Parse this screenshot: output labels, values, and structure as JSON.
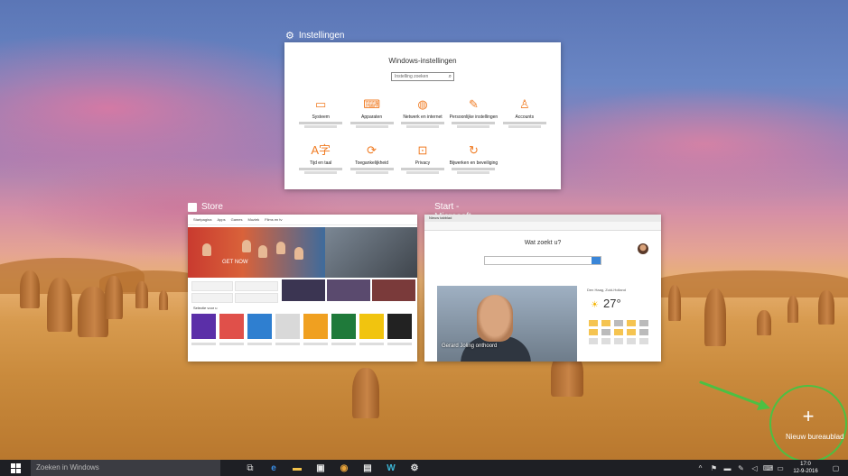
{
  "windows": {
    "settings": {
      "title": "Instellingen",
      "heading": "Windows-instellingen",
      "search_placeholder": "Instelling zoeken",
      "items": [
        {
          "label": "Systeem",
          "icon": "laptop-icon",
          "glyph": "▭"
        },
        {
          "label": "Apparaten",
          "icon": "keyboard-icon",
          "glyph": "⌨"
        },
        {
          "label": "Netwerk en internet",
          "icon": "globe-icon",
          "glyph": "◍"
        },
        {
          "label": "Persoonlijke instellingen",
          "icon": "brush-icon",
          "glyph": "✎"
        },
        {
          "label": "Accounts",
          "icon": "person-icon",
          "glyph": "♙"
        },
        {
          "label": "Tijd en taal",
          "icon": "time-language-icon",
          "glyph": "A字"
        },
        {
          "label": "Toegankelijkheid",
          "icon": "ease-of-access-icon",
          "glyph": "⟳"
        },
        {
          "label": "Privacy",
          "icon": "lock-icon",
          "glyph": "⊡"
        },
        {
          "label": "Bijwerken en beveiliging",
          "icon": "update-icon",
          "glyph": "↻"
        }
      ]
    },
    "store": {
      "title": "Store",
      "nav": [
        "Startpagina",
        "Apps",
        "Games",
        "Muziek",
        "Films en tv"
      ],
      "hero_caption": "GET NOW",
      "row_label": "Selectie voor u"
    },
    "edge": {
      "title": "Start - Microsoft Edge",
      "tab_label": "Nieuw tabblad",
      "heading": "Wat zoekt u?",
      "news_caption": "Gerard Joling onthoord",
      "weather_label": "Den Haag, Zuid-Holland",
      "weather_temp": "27°"
    }
  },
  "new_desktop": {
    "label": "Nieuw bureaublad",
    "plus": "+"
  },
  "taskbar": {
    "search_placeholder": "Zoeken in Windows",
    "apps": [
      {
        "name": "edge-icon",
        "glyph": "e",
        "color": "#3a8ee6"
      },
      {
        "name": "file-explorer-icon",
        "glyph": "▬",
        "color": "#f2c14a"
      },
      {
        "name": "store-icon",
        "glyph": "▣",
        "color": "#e8e8e8"
      },
      {
        "name": "chrome-icon",
        "glyph": "◉",
        "color": "#e8a33a"
      },
      {
        "name": "app-icon",
        "glyph": "▤",
        "color": "#e8e8e8"
      },
      {
        "name": "app-icon-2",
        "glyph": "W",
        "color": "#3db7d8"
      },
      {
        "name": "settings-icon",
        "glyph": "⚙",
        "color": "#e8e8e8"
      }
    ],
    "tray": [
      {
        "name": "chevron-up-icon",
        "glyph": "^"
      },
      {
        "name": "people-icon",
        "glyph": "⚑"
      },
      {
        "name": "network-icon",
        "glyph": "▬"
      },
      {
        "name": "pen-icon",
        "glyph": "✎"
      },
      {
        "name": "volume-icon",
        "glyph": "◁"
      },
      {
        "name": "keyboard-icon",
        "glyph": "⌨"
      }
    ],
    "time": "17:0",
    "date": "12-9-2016"
  }
}
